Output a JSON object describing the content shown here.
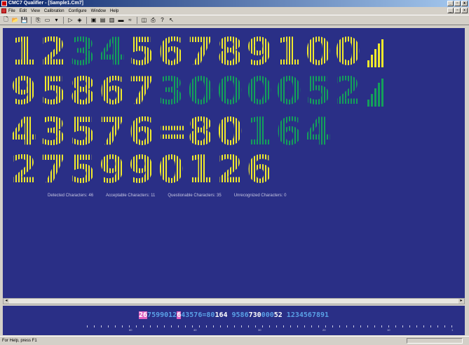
{
  "window": {
    "title": "CMC7 Qualifier - [Sample1.Cm7]",
    "min": "_",
    "max": "▫",
    "close": "x"
  },
  "menu": {
    "items": [
      "File",
      "Edit",
      "View",
      "Calibration",
      "Configure",
      "Window",
      "Help"
    ]
  },
  "toolbar": {
    "icons": [
      "new-icon",
      "open-icon",
      "save-icon",
      "copy-icon",
      "cut-icon",
      "paste-icon",
      "play-icon",
      "stop-icon",
      "zoom-icon",
      "grid-icon",
      "barcode-icon",
      "chart-icon",
      "export-icon",
      "print-icon",
      "help-icon",
      "context-help-icon"
    ]
  },
  "document": {
    "rows": [
      [
        {
          "ch": "1",
          "c": "y"
        },
        {
          "ch": "2",
          "c": "y"
        },
        {
          "ch": "3",
          "c": "g"
        },
        {
          "ch": "4",
          "c": "g"
        },
        {
          "ch": "5",
          "c": "y"
        },
        {
          "ch": "6",
          "c": "y"
        },
        {
          "ch": "7",
          "c": "y"
        },
        {
          "ch": "8",
          "c": "y"
        },
        {
          "ch": "9",
          "c": "y"
        },
        {
          "ch": "1",
          "c": "y"
        },
        {
          "ch": "0",
          "c": "y"
        },
        {
          "ch": "0",
          "c": "y"
        },
        {
          "ch": "bars",
          "c": "y"
        }
      ],
      [
        {
          "ch": "9",
          "c": "y"
        },
        {
          "ch": "5",
          "c": "y"
        },
        {
          "ch": "8",
          "c": "y"
        },
        {
          "ch": "6",
          "c": "y"
        },
        {
          "ch": "7",
          "c": "y"
        },
        {
          "ch": "3",
          "c": "g"
        },
        {
          "ch": "0",
          "c": "g"
        },
        {
          "ch": "0",
          "c": "g"
        },
        {
          "ch": "0",
          "c": "g"
        },
        {
          "ch": "0",
          "c": "g"
        },
        {
          "ch": "5",
          "c": "g"
        },
        {
          "ch": "2",
          "c": "g"
        },
        {
          "ch": "bars",
          "c": "g"
        }
      ],
      [
        {
          "ch": "4",
          "c": "y"
        },
        {
          "ch": "3",
          "c": "y"
        },
        {
          "ch": "5",
          "c": "y"
        },
        {
          "ch": "7",
          "c": "y"
        },
        {
          "ch": "6",
          "c": "y"
        },
        {
          "ch": "=",
          "c": "y"
        },
        {
          "ch": "8",
          "c": "y"
        },
        {
          "ch": "0",
          "c": "y"
        },
        {
          "ch": "1",
          "c": "g"
        },
        {
          "ch": "6",
          "c": "g"
        },
        {
          "ch": "4",
          "c": "g"
        }
      ],
      [
        {
          "ch": "2",
          "c": "y"
        },
        {
          "ch": "7",
          "c": "y"
        },
        {
          "ch": "5",
          "c": "y"
        },
        {
          "ch": "9",
          "c": "y"
        },
        {
          "ch": "9",
          "c": "y"
        },
        {
          "ch": "0",
          "c": "y"
        },
        {
          "ch": "1",
          "c": "y"
        },
        {
          "ch": "2",
          "c": "y"
        },
        {
          "ch": "6",
          "c": "y"
        }
      ]
    ],
    "stats": {
      "detected": "Detected Characters: 46",
      "acceptable": "Acceptable Characters: 11",
      "questionable": "Questionable Characters: 35",
      "unrecognized": "Unrecognized Characters: 0"
    }
  },
  "strip": {
    "segments": [
      {
        "text": "26",
        "kind": "sel"
      },
      {
        "text": "7599012",
        "kind": "q"
      },
      {
        "text": "6",
        "kind": "sel"
      },
      {
        "text": "4",
        "kind": "q"
      },
      {
        "text": "3576",
        "kind": "q"
      },
      {
        "text": "=",
        "kind": "q"
      },
      {
        "text": "80",
        "kind": "q"
      },
      {
        "text": "164",
        "kind": "ok"
      },
      {
        "text": "  9586",
        "kind": "q"
      },
      {
        "text": "730",
        "kind": "ok"
      },
      {
        "text": "000",
        "kind": "q"
      },
      {
        "text": "52",
        "kind": "ok"
      },
      {
        "text": "  1234",
        "kind": "q"
      },
      {
        "text": "567891",
        "kind": "q"
      }
    ],
    "ruler_labels": [
      "60",
      "40",
      "30",
      "20",
      "10",
      "1"
    ]
  },
  "status": {
    "text": "For Help, press F1"
  }
}
